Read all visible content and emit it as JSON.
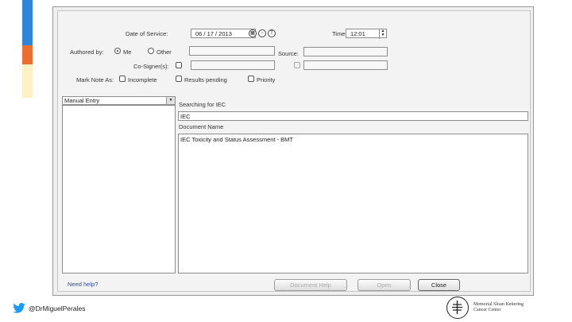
{
  "dialog": {
    "date_of_service_label": "Date of Service:",
    "date_value": "06 / 17 / 2013",
    "time_label": "Time:",
    "time_value": "12:01",
    "authored_by_label": "Authored by:",
    "authored_me": "Me",
    "authored_other": "Other",
    "source_label": "Source:",
    "cosigner_label": "Co-Signer(s):",
    "mark_note_label": "Mark Note As:",
    "mark_incomplete": "Incomplete",
    "mark_results_pending": "Results pending",
    "mark_priority": "Priority",
    "manual_entry_value": "Manual Entry",
    "searching_label": "Searching for IEC",
    "search_value": "IEC",
    "document_name_label": "Document Name",
    "document_list": [
      "IEC Toxicity and Status Assessment - BMT"
    ],
    "need_help_label": "Need help?",
    "buttons": {
      "document_help": "Document Help",
      "open": "Open",
      "close": "Close"
    }
  },
  "footer": {
    "twitter_handle": "@DrMiguelPerales",
    "logo_line1": "Memorial Sloan Kettering",
    "logo_line2": "Cancer Center"
  }
}
